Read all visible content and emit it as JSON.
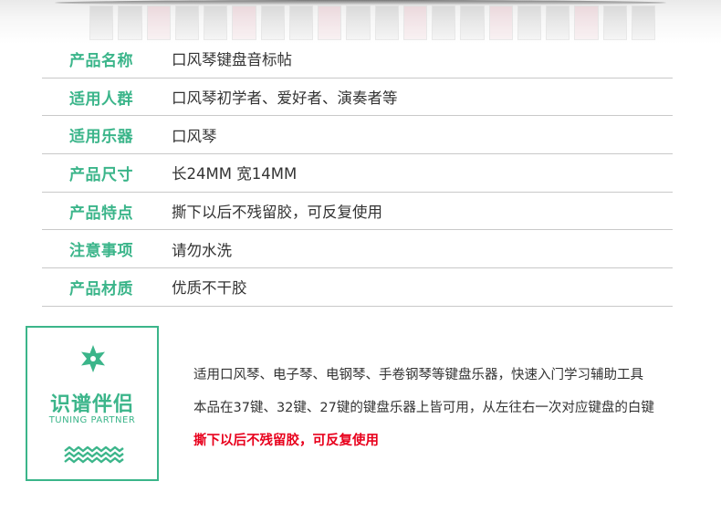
{
  "colors": {
    "accent": "#3bb58a",
    "text": "#333333",
    "warning": "#e8001c",
    "divider": "#c9c9c9"
  },
  "specs": [
    {
      "label": "产品名称",
      "value": "口风琴键盘音标帖"
    },
    {
      "label": "适用人群",
      "value": "口风琴初学者、爱好者、演奏者等"
    },
    {
      "label": "适用乐器",
      "value": "口风琴"
    },
    {
      "label": "产品尺寸",
      "value": "长24MM 宽14MM"
    },
    {
      "label": "产品特点",
      "value": "撕下以后不残留胶，可反复使用"
    },
    {
      "label": "注意事项",
      "value": "请勿水洗"
    },
    {
      "label": "产品材质",
      "value": "优质不干胶"
    }
  ],
  "badge": {
    "icon": "star-icon",
    "title": "识谱伴侣",
    "subtitle": "TUNING PARTNER",
    "decoration": "wave-icon"
  },
  "description": {
    "line1": "适用口风琴、电子琴、电钢琴、手卷钢琴等键盘乐器，快速入门学习辅助工具",
    "line2": "本品在37键、32键、27键的键盘乐器上皆可用，从左往右一次对应键盘的白键",
    "line3": "撕下以后不残留胶，可反复使用"
  }
}
